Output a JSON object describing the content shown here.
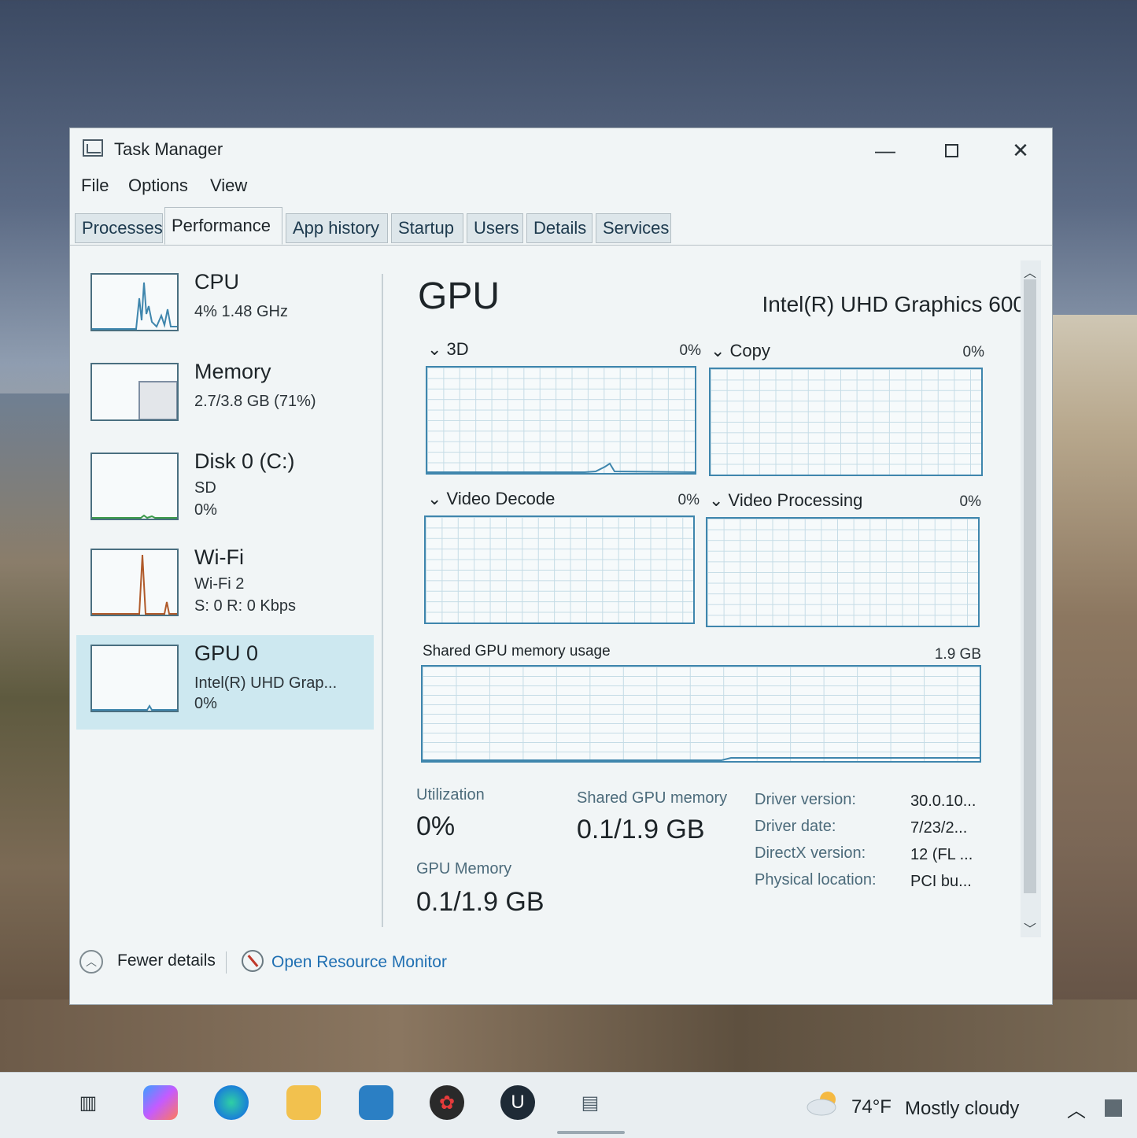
{
  "window": {
    "title": "Task Manager",
    "controls": {
      "minimize": "—",
      "maximize": "",
      "close": "✕"
    }
  },
  "menu": [
    "File",
    "Options",
    "View"
  ],
  "tabs": [
    "Processes",
    "Performance",
    "App history",
    "Startup",
    "Users",
    "Details",
    "Services"
  ],
  "active_tab": "Performance",
  "sidebar": {
    "items": [
      {
        "name": "CPU",
        "line1": "4%  1.48 GHz",
        "line2": ""
      },
      {
        "name": "Memory",
        "line1": "2.7/3.8 GB (71%)",
        "line2": ""
      },
      {
        "name": "Disk 0 (C:)",
        "line1": "SD",
        "line2": "0%"
      },
      {
        "name": "Wi-Fi",
        "line1": "Wi-Fi 2",
        "line2": "S: 0 R: 0 Kbps"
      },
      {
        "name": "GPU 0",
        "line1": "Intel(R) UHD Grap...",
        "line2": "0%"
      }
    ],
    "selected": "GPU 0"
  },
  "gpu": {
    "title": "GPU",
    "model": "Intel(R) UHD Graphics 600",
    "engines": [
      {
        "label": "3D",
        "percent": "0%"
      },
      {
        "label": "Copy",
        "percent": "0%"
      },
      {
        "label": "Video Decode",
        "percent": "0%"
      },
      {
        "label": "Video Processing",
        "percent": "0%"
      }
    ],
    "shared_memory_graph": {
      "label": "Shared GPU memory usage",
      "max": "1.9 GB"
    },
    "stats": {
      "utilization_label": "Utilization",
      "utilization_value": "0%",
      "shared_label": "Shared GPU memory",
      "shared_value": "0.1/1.9 GB",
      "gpu_memory_label": "GPU Memory",
      "gpu_memory_value": "0.1/1.9 GB"
    },
    "details": [
      {
        "label": "Driver version:",
        "value": "30.0.10..."
      },
      {
        "label": "Driver date:",
        "value": "7/23/2..."
      },
      {
        "label": "DirectX version:",
        "value": "12 (FL ..."
      },
      {
        "label": "Physical location:",
        "value": "PCI bu..."
      }
    ]
  },
  "footer": {
    "fewer_details": "Fewer details",
    "open_resource_monitor": "Open Resource Monitor"
  },
  "taskbar": {
    "weather_temp": "74°F",
    "weather_desc": "Mostly cloudy"
  },
  "colors": {
    "accent_blue": "#3f86ad",
    "selected_bg": "#cde8f0",
    "link": "#1f6fb2"
  }
}
